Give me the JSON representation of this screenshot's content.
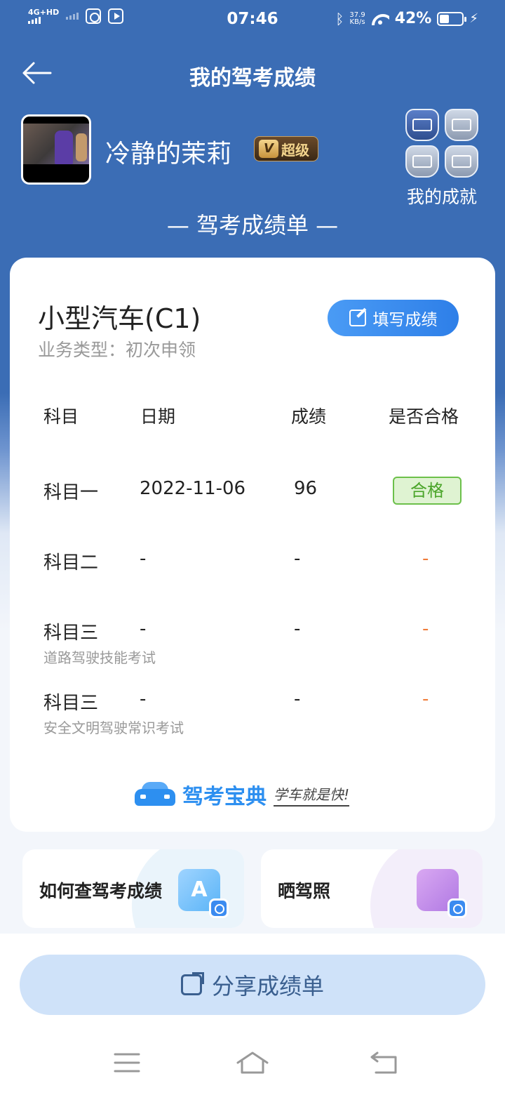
{
  "status_bar": {
    "network_label": "4G+HD",
    "time": "07:46",
    "net_speed_value": "37.9",
    "net_speed_unit": "KB/s",
    "battery_text": "42%",
    "battery_level": 0.42
  },
  "header": {
    "title": "我的驾考成绩"
  },
  "profile": {
    "username": "冷静的茉莉",
    "vip_label": "超级",
    "vip_letter": "V",
    "achievements_label": "我的成就"
  },
  "sheet_heading": "— 驾考成绩单 —",
  "card": {
    "vehicle_type": "小型汽车(C1)",
    "business_type": "业务类型：初次申领",
    "fill_button_label": "填写成绩",
    "columns": [
      "科目",
      "日期",
      "成绩",
      "是否合格"
    ],
    "rows": [
      {
        "subject": "科目一",
        "subtitle": "",
        "date": "2022-11-06",
        "score": "96",
        "result": "合格"
      },
      {
        "subject": "科目二",
        "subtitle": "",
        "date": "-",
        "score": "-",
        "result": "-"
      },
      {
        "subject": "科目三",
        "subtitle": "道路驾驶技能考试",
        "date": "-",
        "score": "-",
        "result": "-"
      },
      {
        "subject": "科目三",
        "subtitle": "安全文明驾驶常识考试",
        "date": "-",
        "score": "-",
        "result": "-"
      }
    ],
    "brand_name": "驾考宝典",
    "brand_slogan": "学车就是快!"
  },
  "tiles": [
    {
      "label": "如何查驾考成绩",
      "icon": "search-doc-icon",
      "icon_glyph": "A"
    },
    {
      "label": "晒驾照",
      "icon": "photo-icon"
    }
  ],
  "share_button_label": "分享成绩单",
  "colors": {
    "primary": "#3b6db5",
    "accent_blue": "#2e7fe8",
    "pass_green": "#4ba52a",
    "pending_orange": "#f07b38"
  }
}
